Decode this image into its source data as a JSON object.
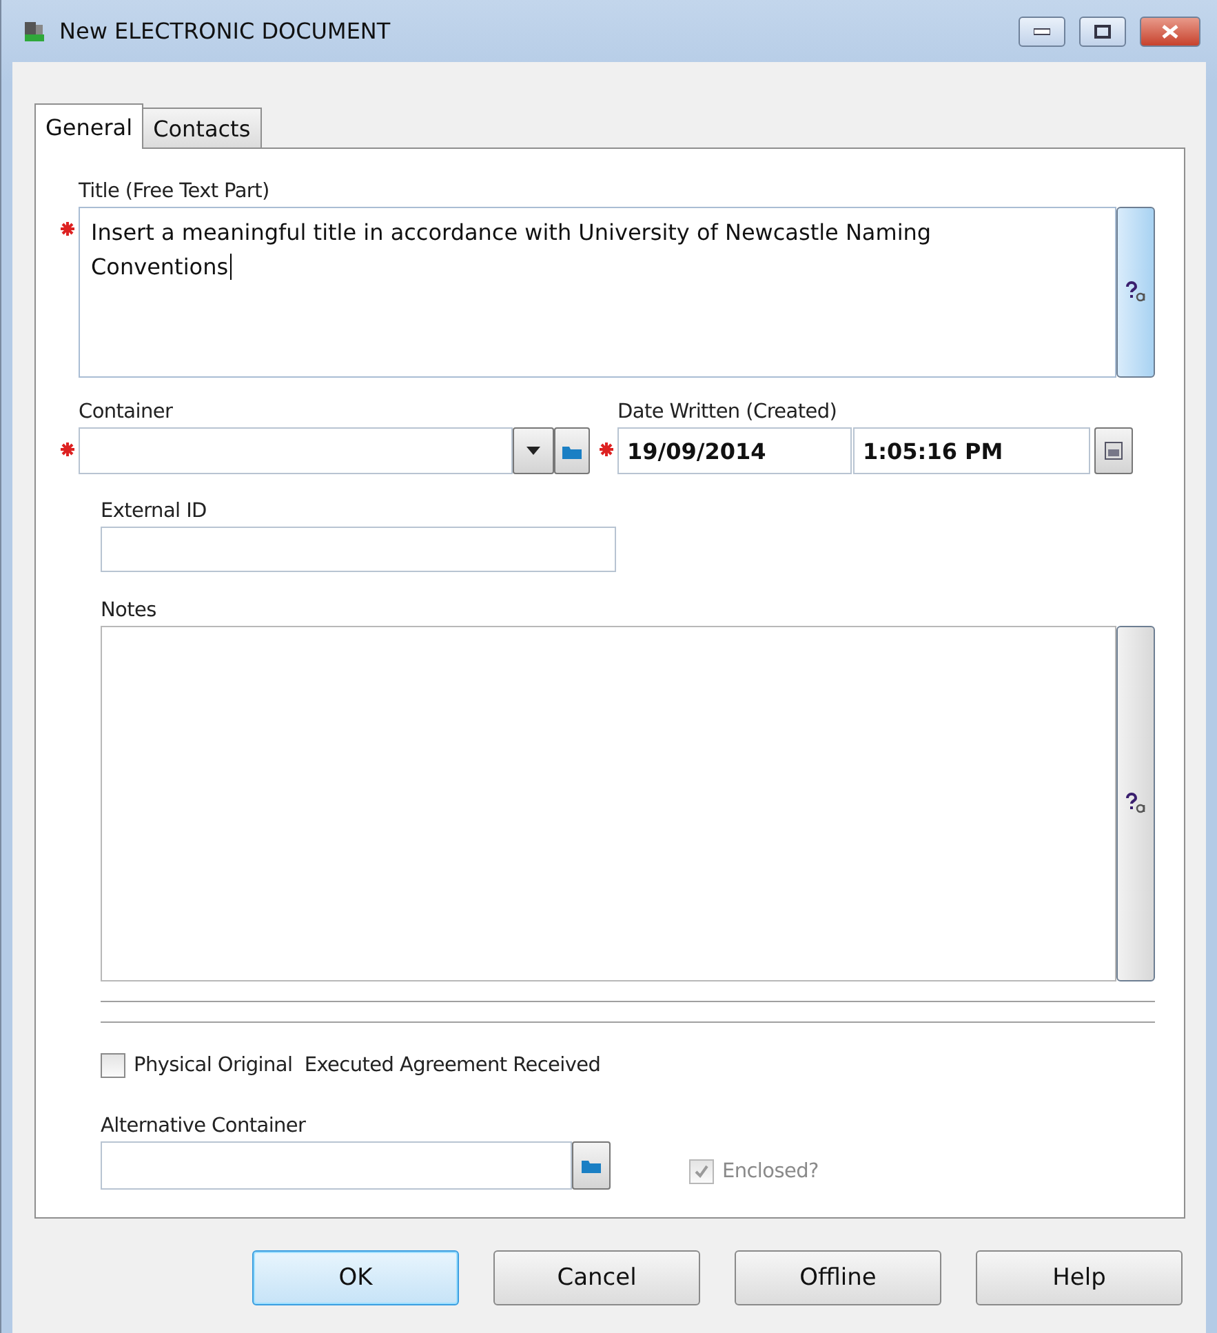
{
  "window": {
    "title": "New ELECTRONIC DOCUMENT"
  },
  "tabs": [
    {
      "label": "General",
      "selected": true
    },
    {
      "label": "Contacts",
      "selected": false
    }
  ],
  "title_field": {
    "label": "Title (Free Text Part)",
    "value": "Insert a meaningful title in accordance with University of Newcastle Naming Conventions",
    "required": true
  },
  "container": {
    "label": "Container",
    "required": true
  },
  "date_written": {
    "label": "Date Written (Created)",
    "date": "19/09/2014",
    "time": "1:05:16 PM",
    "required": true
  },
  "external_id": {
    "label": "External ID"
  },
  "notes": {
    "label": "Notes"
  },
  "physical_original": {
    "label": "Physical Original  Executed Agreement Received",
    "checked": false,
    "disabled": false
  },
  "alternative_container": {
    "label": "Alternative Container"
  },
  "enclosed": {
    "label": "Enclosed?",
    "checked": true,
    "disabled": true
  },
  "buttons": [
    {
      "label": "OK",
      "default": true
    },
    {
      "label": "Cancel",
      "default": false
    },
    {
      "label": "Offline",
      "default": false
    },
    {
      "label": "Help",
      "default": false
    }
  ]
}
